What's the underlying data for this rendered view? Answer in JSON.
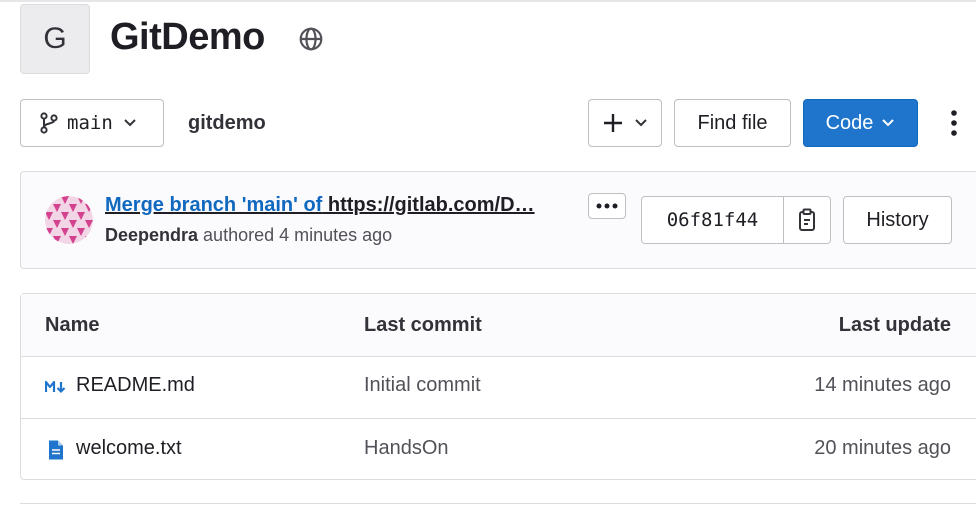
{
  "project": {
    "avatar_letter": "G",
    "name": "GitDemo",
    "visibility_icon": "globe-icon"
  },
  "toolbar": {
    "branch": "main",
    "repo_path": "gitdemo",
    "add_icon": "plus-icon",
    "find_file_label": "Find file",
    "code_label": "Code",
    "more_icon": "kebab-vertical-icon"
  },
  "last_commit": {
    "title_link": "Merge branch 'main' of",
    "title_rest": " https://gitlab.com/D…",
    "author": "Deependra",
    "meta": " authored 4 minutes ago",
    "sha": "06f81f44",
    "history_label": "History"
  },
  "files": {
    "headers": {
      "name": "Name",
      "last_commit": "Last commit",
      "last_update": "Last update"
    },
    "rows": [
      {
        "icon": "markdown-icon",
        "name": "README.md",
        "commit": "Initial commit",
        "updated": "14 minutes ago"
      },
      {
        "icon": "file-text-icon",
        "name": "welcome.txt",
        "commit": "HandsOn",
        "updated": "20 minutes ago"
      }
    ]
  },
  "colors": {
    "primary": "#1f75cb",
    "link": "#1068bf",
    "file_icon": "#1f75cb",
    "avatar_pink": "#d4418e"
  }
}
